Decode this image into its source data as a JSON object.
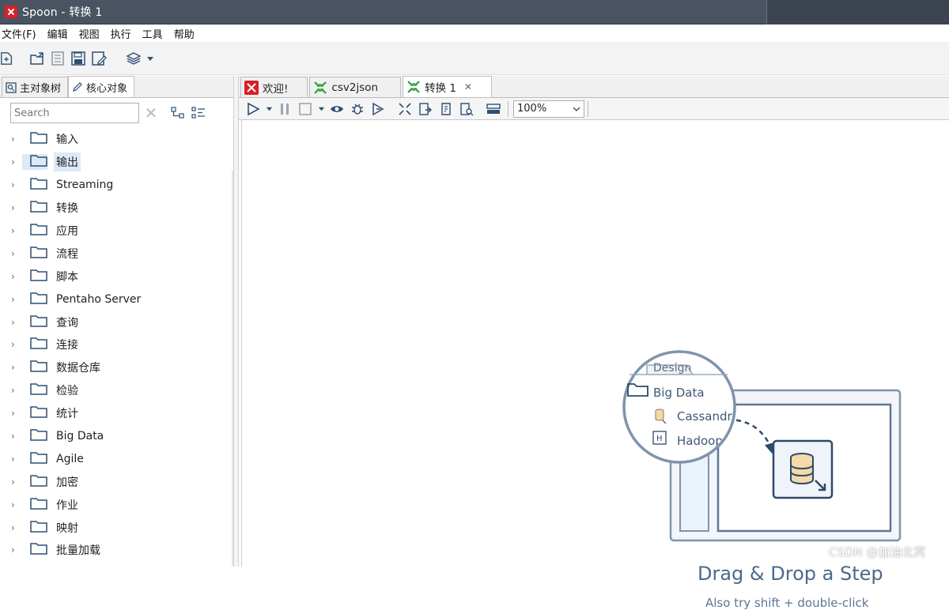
{
  "window": {
    "title": "Spoon - 转换 1"
  },
  "menu": [
    "文件(F)",
    "编辑",
    "视图",
    "执行",
    "工具",
    "帮助"
  ],
  "left_panel": {
    "tabs": [
      {
        "label": "主对象树",
        "icon": "tree-icon",
        "active": false
      },
      {
        "label": "核心对象",
        "icon": "pencil-icon",
        "active": true
      }
    ],
    "search": {
      "placeholder": "Search",
      "value": ""
    },
    "tree_items": [
      {
        "label": "输入",
        "selected": false
      },
      {
        "label": "输出",
        "selected": true
      },
      {
        "label": "Streaming",
        "selected": false
      },
      {
        "label": "转换",
        "selected": false
      },
      {
        "label": "应用",
        "selected": false
      },
      {
        "label": "流程",
        "selected": false
      },
      {
        "label": "脚本",
        "selected": false
      },
      {
        "label": "Pentaho Server",
        "selected": false
      },
      {
        "label": "查询",
        "selected": false
      },
      {
        "label": "连接",
        "selected": false
      },
      {
        "label": "数据仓库",
        "selected": false
      },
      {
        "label": "检验",
        "selected": false
      },
      {
        "label": "统计",
        "selected": false
      },
      {
        "label": "Big Data",
        "selected": false
      },
      {
        "label": "Agile",
        "selected": false
      },
      {
        "label": "加密",
        "selected": false
      },
      {
        "label": "作业",
        "selected": false
      },
      {
        "label": "映射",
        "selected": false
      },
      {
        "label": "批量加载",
        "selected": false
      }
    ]
  },
  "doc_tabs": [
    {
      "label": "欢迎!",
      "icon": "spoon-icon",
      "active": false
    },
    {
      "label": "csv2json",
      "icon": "transformation-icon",
      "active": false
    },
    {
      "label": "转换 1",
      "icon": "transformation-icon",
      "active": true,
      "closable": true
    }
  ],
  "zoom": "100%",
  "canvas_hint": {
    "panel_tab": "Design",
    "folder": "Big Data",
    "items": [
      "Cassandr",
      "Hadoop"
    ],
    "title": "Drag & Drop a Step",
    "subtitle": "Also try shift + double-click"
  },
  "watermark": "CSDN @加油北冥",
  "colors": {
    "titlebar": "#4a5361",
    "selection": "#dce9f6",
    "hint": "#4b6a8a",
    "spoon_red": "#d6202a",
    "trans_green": "#2e9e3e"
  }
}
